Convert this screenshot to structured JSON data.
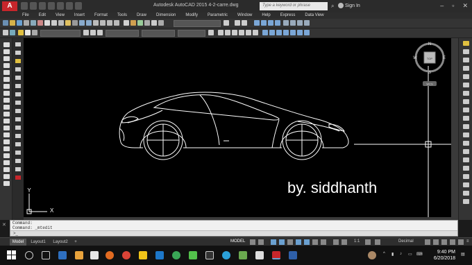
{
  "app": {
    "logo": "A",
    "window_title": "Autodesk AutoCAD 2015    4-2-carre.dwg",
    "search_placeholder": "Type a keyword or phrase",
    "sign_in": "Sign In"
  },
  "menu": [
    "File",
    "Edit",
    "View",
    "Insert",
    "Format",
    "Tools",
    "Draw",
    "Dimension",
    "Modify",
    "Parametric",
    "Window",
    "Help",
    "Express",
    "Data View"
  ],
  "drawing": {
    "annotation": "by. siddhanth",
    "ucs_x": "X",
    "ucs_y": "Y",
    "viewcube": {
      "top": "TOP",
      "n": "N",
      "s": "S",
      "e": "E",
      "w": "W",
      "wcs": "WCS"
    }
  },
  "command": {
    "lines": [
      "Command:",
      "Command: _mtedit"
    ],
    "prompt": ">_"
  },
  "layout_tabs": [
    "Model",
    "Layout1",
    "Layout2"
  ],
  "status": {
    "model": "MODEL",
    "scale": "1:1",
    "units": "Decimal"
  },
  "taskbar": {
    "time": "9:40 PM",
    "date": "6/20/2018"
  },
  "colors": {
    "accent": "#c7262b",
    "drawing_bg": "#000000",
    "linework": "#ffffff"
  }
}
